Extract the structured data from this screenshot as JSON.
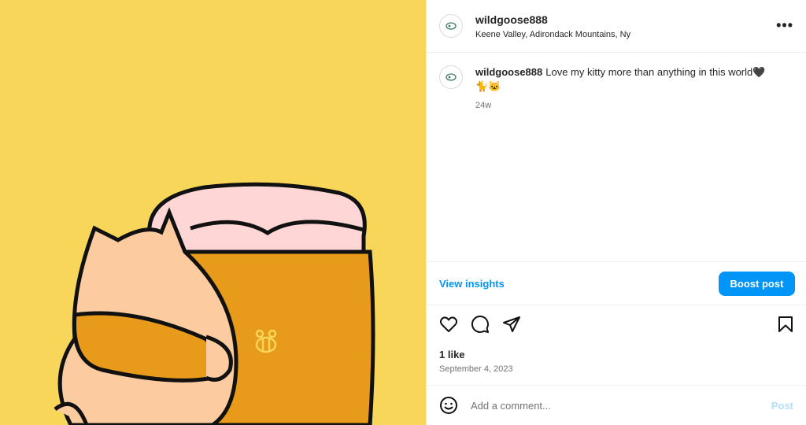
{
  "post": {
    "username": "wildgoose888",
    "location": "Keene Valley, Adirondack Mountains, Ny",
    "caption": "Love my kitty more than anything in this world🖤",
    "caption_emojis": "🐈🐱",
    "time_ago": "24w"
  },
  "insights": {
    "view_label": "View insights",
    "boost_label": "Boost post"
  },
  "stats": {
    "likes": "1 like",
    "date": "September 4, 2023"
  },
  "comment": {
    "placeholder": "Add a comment...",
    "post_label": "Post"
  },
  "colors": {
    "image_background": "#f8d65a",
    "accent": "#0095f6"
  }
}
